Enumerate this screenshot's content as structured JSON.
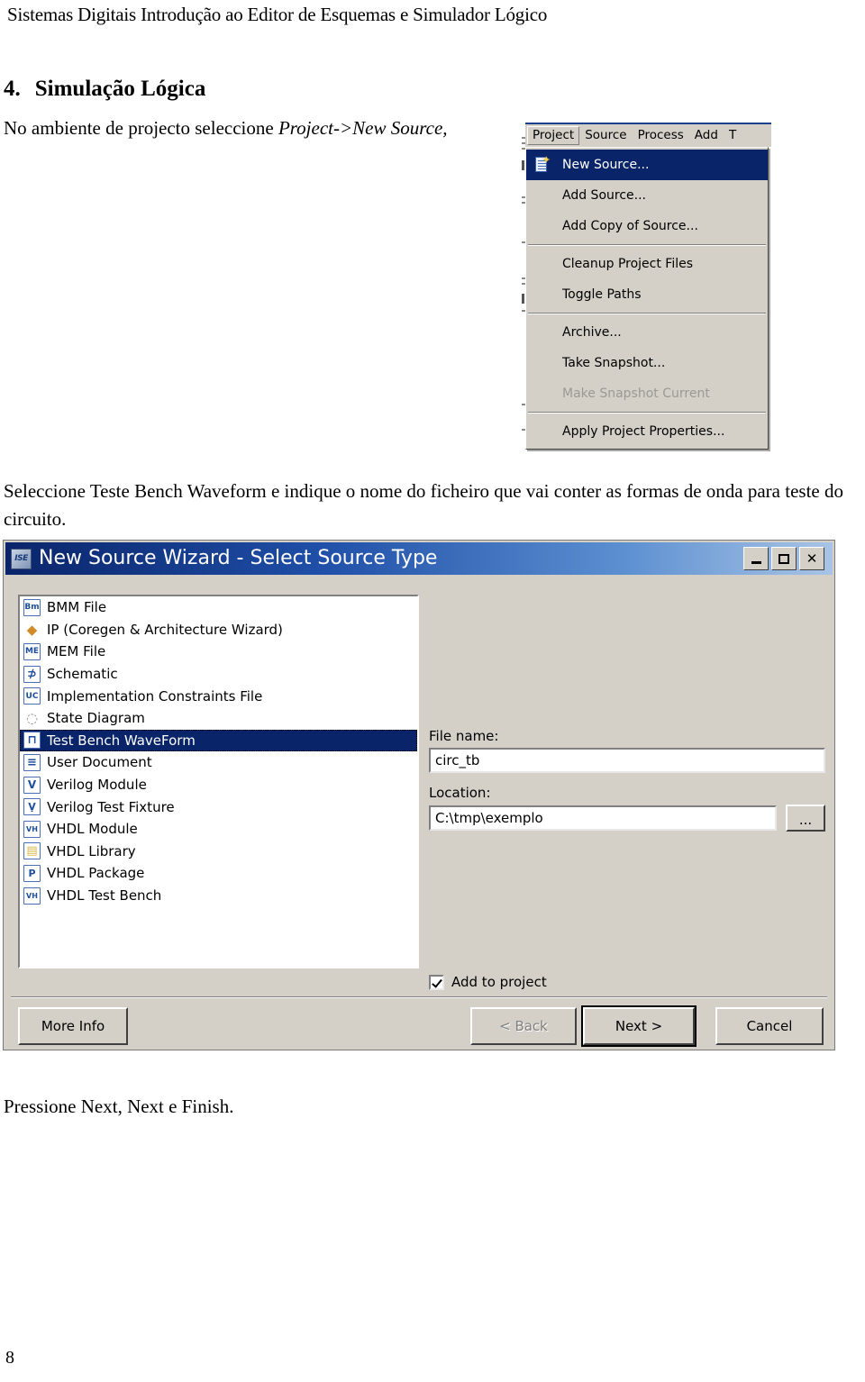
{
  "document": {
    "running_header": "Sistemas Digitais Introdução ao Editor de Esquemas e Simulador Lógico",
    "section_number": "4.",
    "section_title": "Simulação Lógica",
    "intro_text_before": "No ambiente de projecto seleccione ",
    "intro_text_italic": "Project->New Source,",
    "middle_paragraph": "Seleccione Teste Bench Waveform e indique o nome do ficheiro que vai conter as formas de onda para teste do circuito.",
    "closing_paragraph": "Pressione Next, Next e Finish.",
    "page_number": "8"
  },
  "ise_menu": {
    "menubar": [
      {
        "label": "Project",
        "active": true
      },
      {
        "label": "Source",
        "active": false
      },
      {
        "label": "Process",
        "active": false
      },
      {
        "label": "Add",
        "active": false
      },
      {
        "label": "T",
        "active": false
      }
    ],
    "dropdown_items": [
      {
        "label": "New Source...",
        "selected": true,
        "disabled": false,
        "icon": "new-source-icon",
        "separator_after": false
      },
      {
        "label": "Add Source...",
        "selected": false,
        "disabled": false,
        "icon": "",
        "separator_after": false
      },
      {
        "label": "Add Copy of Source...",
        "selected": false,
        "disabled": false,
        "icon": "",
        "separator_after": true
      },
      {
        "label": "Cleanup Project Files",
        "selected": false,
        "disabled": false,
        "icon": "",
        "separator_after": false
      },
      {
        "label": "Toggle Paths",
        "selected": false,
        "disabled": false,
        "icon": "",
        "separator_after": true
      },
      {
        "label": "Archive...",
        "selected": false,
        "disabled": false,
        "icon": "",
        "separator_after": false
      },
      {
        "label": "Take Snapshot...",
        "selected": false,
        "disabled": false,
        "icon": "",
        "separator_after": false
      },
      {
        "label": "Make Snapshot Current",
        "selected": false,
        "disabled": true,
        "icon": "",
        "separator_after": true
      },
      {
        "label": "Apply Project Properties...",
        "selected": false,
        "disabled": false,
        "icon": "",
        "separator_after": false
      }
    ]
  },
  "wizard": {
    "app_icon_label": "ISE",
    "title": "New Source Wizard - Select Source Type",
    "window_buttons": {
      "minimize": "minimize-icon",
      "maximize": "maximize-icon",
      "close": "✕"
    },
    "source_types": [
      {
        "label": "BMM File",
        "glyph": "Bm",
        "selected": false
      },
      {
        "label": "IP (Coregen & Architecture Wizard)",
        "glyph": "◆",
        "selected": false
      },
      {
        "label": "MEM File",
        "glyph": "ME",
        "selected": false
      },
      {
        "label": "Schematic",
        "glyph": "⊅",
        "selected": false
      },
      {
        "label": "Implementation Constraints File",
        "glyph": "UC",
        "selected": false
      },
      {
        "label": "State Diagram",
        "glyph": "◌",
        "selected": false
      },
      {
        "label": "Test Bench WaveForm",
        "glyph": "⊓",
        "selected": true
      },
      {
        "label": "User Document",
        "glyph": "≡",
        "selected": false
      },
      {
        "label": "Verilog Module",
        "glyph": "V",
        "selected": false
      },
      {
        "label": "Verilog Test Fixture",
        "glyph": "Ṿ",
        "selected": false
      },
      {
        "label": "VHDL Module",
        "glyph": "VH",
        "selected": false
      },
      {
        "label": "VHDL Library",
        "glyph": "▤",
        "selected": false
      },
      {
        "label": "VHDL Package",
        "glyph": "P",
        "selected": false
      },
      {
        "label": "VHDL Test Bench",
        "glyph": "VH",
        "selected": false
      }
    ],
    "fields": {
      "file_name_label": "File name:",
      "file_name_value": "circ_tb",
      "file_name_placeholder": "",
      "location_label": "Location:",
      "location_value": "C:\\tmp\\exemplo",
      "location_placeholder": "",
      "browse_label": "..."
    },
    "add_to_project_label": "Add to project",
    "add_to_project_checked": true,
    "buttons": {
      "more_info": "More Info",
      "back": "< Back",
      "next": "Next >",
      "cancel": "Cancel"
    }
  },
  "colors": {
    "title_gradient_start": "#0a246a",
    "title_gradient_end": "#a8c4e6",
    "selection_blue": "#0a246a",
    "dialog_face": "#d4d0c8"
  }
}
